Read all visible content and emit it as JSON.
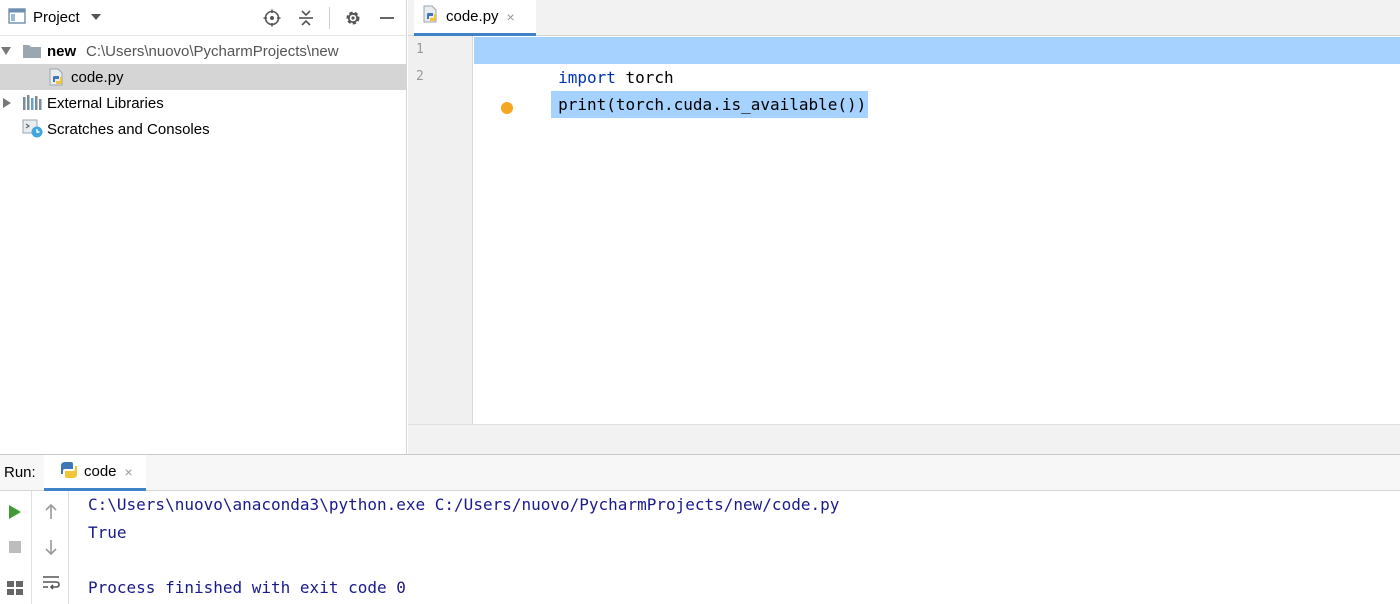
{
  "project_panel": {
    "title": "Project",
    "tree": [
      {
        "label": "new",
        "path": "C:\\Users\\nuovo\\PycharmProjects\\new"
      },
      {
        "label": "code.py"
      },
      {
        "label": "External Libraries"
      },
      {
        "label": "Scratches and Consoles"
      }
    ]
  },
  "editor": {
    "tab_label": "code.py",
    "tab_close": "×",
    "lines": [
      {
        "number": "1",
        "keyword": "import",
        "rest": " torch"
      },
      {
        "number": "2",
        "text": "print(torch.cuda.is_available())"
      }
    ]
  },
  "run": {
    "title": "Run:",
    "tab_label": "code",
    "tab_close": "×",
    "console": [
      "C:\\Users\\nuovo\\anaconda3\\python.exe C:/Users/nuovo/PycharmProjects/new/code.py",
      "True",
      "Process finished with exit code 0"
    ]
  },
  "colors": {
    "selection": "#a6d2ff",
    "keyword": "#0033b3",
    "console_text": "#1a1a8c",
    "run_green": "#3f9c35",
    "tab_underline": "#4083c9"
  }
}
